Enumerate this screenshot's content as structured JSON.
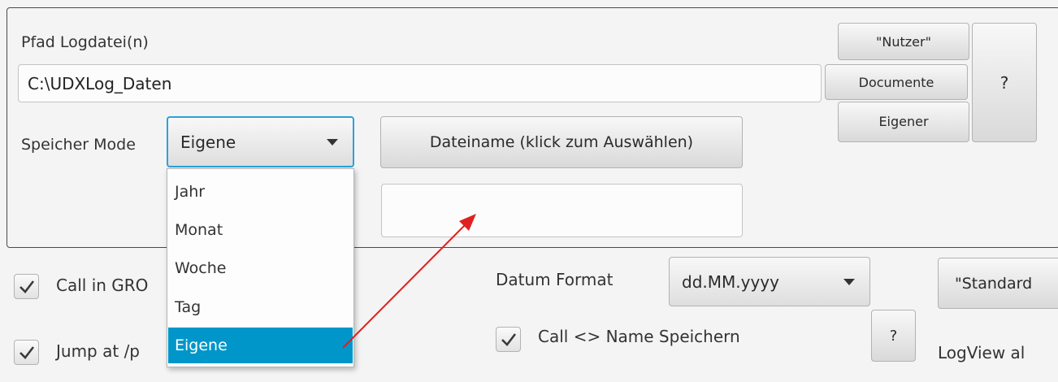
{
  "log_path": {
    "label": "Pfad Logdatei(n)",
    "value": "C:\\UDXLog_Daten"
  },
  "path_buttons": {
    "nutzer": "\"Nutzer\"",
    "documente": "Documente",
    "eigener": "Eigener",
    "help": "?"
  },
  "speicher_mode": {
    "label": "Speicher Mode",
    "selected": "Eigene",
    "options": [
      "Jahr",
      "Monat",
      "Woche",
      "Tag",
      "Eigene"
    ]
  },
  "filename": {
    "button_label": "Dateiname (klick zum Auswählen)",
    "value": ""
  },
  "options": {
    "call_in_gro": "Call in GRO",
    "jump_at": "Jump at /p",
    "call_name_save": "Call <> Name Speichern",
    "help": "?"
  },
  "date_format": {
    "label": "Datum Format",
    "selected": "dd.MM.yyyy"
  },
  "standard_button": "\"Standard",
  "logview_label": "LogView al",
  "colors": {
    "accent": "#2aa2db",
    "selection": "#0096c9",
    "annotation_arrow": "#e02020"
  }
}
